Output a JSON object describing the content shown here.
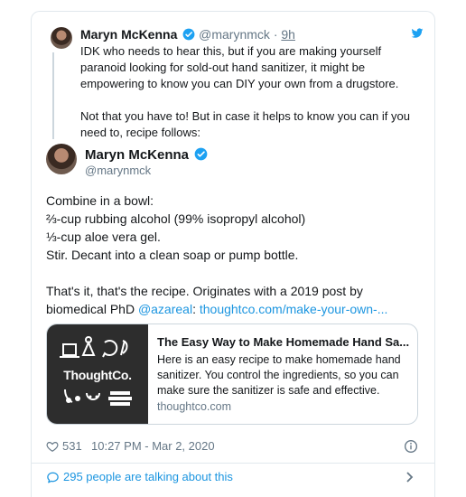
{
  "quoted_tweet": {
    "author_name": "Maryn McKenna",
    "author_handle": "@marynmck",
    "separator": "·",
    "time": "9h",
    "paragraphs": [
      "IDK who needs to hear this, but if you are making yourself paranoid looking for sold-out hand sanitizer, it might be empowering to know you can DIY your own from a drugstore.",
      "Not that you have to! But in case it helps to know you can if you need to, recipe follows:"
    ]
  },
  "tweet": {
    "author_name": "Maryn McKenna",
    "author_handle": "@marynmck",
    "lines": [
      "Combine in a bowl:",
      "⅔-cup rubbing alcohol (99% isopropyl alcohol)",
      "⅓-cup aloe vera gel.",
      "Stir. Decant into a clean soap or pump bottle."
    ],
    "closing_line_1": "That's it, that's the recipe. Originates with a 2019 post by",
    "closing_prefix": "biomedical PhD ",
    "mention": "@azareal",
    "colon": ": ",
    "link_text": "thoughtco.com/make-your-own-..."
  },
  "link_card": {
    "thumb_logo": "ThoughtCo.",
    "title": "The Easy Way to Make Homemade Hand Sa...",
    "description": "Here is an easy recipe to make homemade hand sanitizer. You control the ingredients, so you can make sure the sanitizer is safe and effective.",
    "domain": "thoughtco.com"
  },
  "stats": {
    "likes": "531",
    "timestamp": "10:27 PM - Mar 2, 2020"
  },
  "conversation": {
    "label": "295 people are talking about this"
  },
  "colors": {
    "twitter_blue": "#1b95e0",
    "text_primary": "#14171a",
    "text_secondary": "#657786",
    "border": "#e1e8ed",
    "thumb_background": "#2d2d2d"
  },
  "icons": [
    "verified-badge-icon",
    "twitter-bird-icon",
    "heart-icon",
    "info-icon",
    "speech-bubble-icon",
    "chevron-right-icon"
  ]
}
